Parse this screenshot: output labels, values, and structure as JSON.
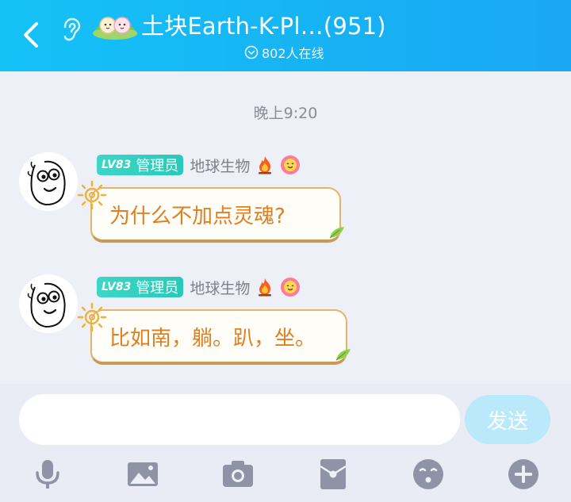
{
  "header": {
    "title": "土块Earth-K-Pl…(951)",
    "online_count": "802人在线"
  },
  "chat": {
    "timestamp": "晚上9:20",
    "messages": [
      {
        "level": "LV83",
        "role": "管理员",
        "nickname": "地球生物",
        "text": "为什么不加点灵魂?"
      },
      {
        "level": "LV83",
        "role": "管理员",
        "nickname": "地球生物",
        "text": "比如南，躺。趴，坐。"
      }
    ]
  },
  "input": {
    "placeholder": "",
    "send_label": "发送"
  },
  "toolbar": {
    "icons": [
      "microphone-icon",
      "image-icon",
      "camera-icon",
      "red-packet-icon",
      "emoji-icon",
      "plus-icon"
    ]
  },
  "colors": {
    "header_start": "#14c2f6",
    "header_end": "#1aa7f3",
    "bubble_text": "#e07f1f",
    "badge": "#2fcfbf",
    "send_button": "#b9e9fb"
  }
}
